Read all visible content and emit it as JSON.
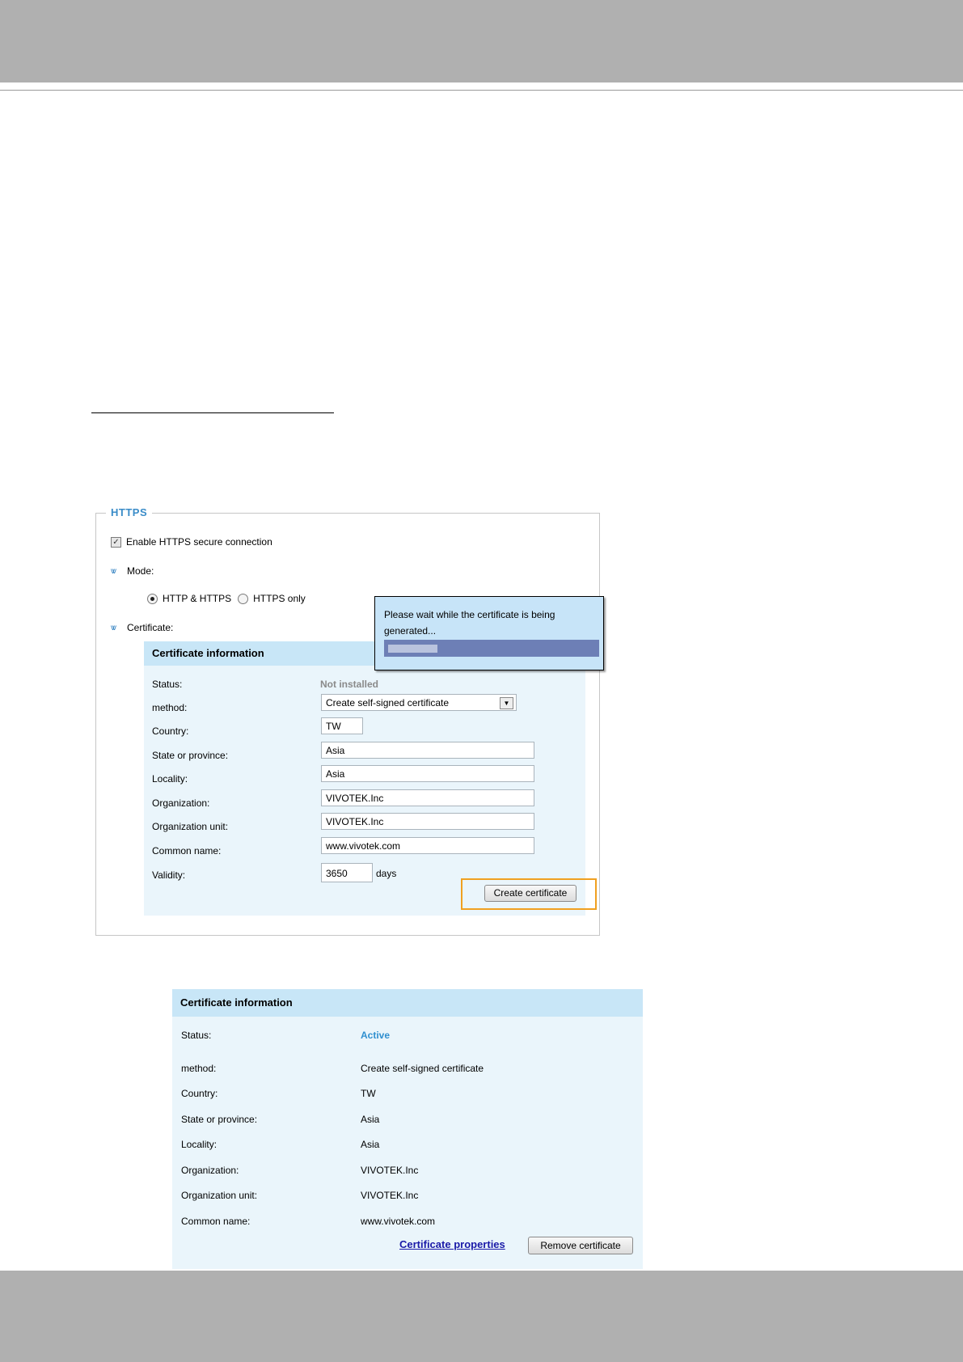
{
  "https": {
    "legend": "HTTPS",
    "enable_label": "Enable HTTPS secure connection",
    "mode_label": "Mode:",
    "mode_options": [
      "HTTP & HTTPS",
      "HTTPS only"
    ],
    "selected_mode": "HTTP & HTTPS",
    "certificate_label": "Certificate:",
    "check_mark": "✓",
    "chevron": "vv"
  },
  "cert_form": {
    "title": "Certificate information",
    "status_label": "Status:",
    "status_value": "Not installed",
    "method_label": "method:",
    "method_value": "Create self-signed certificate",
    "country_label": "Country:",
    "country_value": "TW",
    "state_label": "State or province:",
    "state_value": "Asia",
    "locality_label": "Locality:",
    "locality_value": "Asia",
    "org_label": "Organization:",
    "org_value": "VIVOTEK.Inc",
    "org_unit_label": "Organization unit:",
    "org_unit_value": "VIVOTEK.Inc",
    "common_name_label": "Common name:",
    "common_name_value": "www.vivotek.com",
    "validity_label": "Validity:",
    "validity_value": "3650",
    "validity_unit": "days",
    "create_button": "Create certificate",
    "dropdown_arrow": "▼"
  },
  "popup": {
    "message": "Please wait while the certificate is being generated..."
  },
  "cert_info": {
    "title": "Certificate information",
    "status_label": "Status:",
    "status_value": "Active",
    "method_label": "method:",
    "method_value": "Create self-signed certificate",
    "country_label": "Country:",
    "country_value": "TW",
    "state_label": "State or province:",
    "state_value": "Asia",
    "locality_label": "Locality:",
    "locality_value": "Asia",
    "org_label": "Organization:",
    "org_value": "VIVOTEK.Inc",
    "org_unit_label": "Organization unit:",
    "org_unit_value": "VIVOTEK.Inc",
    "common_name_label": "Common name:",
    "common_name_value": "www.vivotek.com",
    "properties_link": "Certificate properties",
    "remove_button": "Remove certificate"
  },
  "colors": {
    "accent": "#3a8cc8",
    "highlight": "#f0a020",
    "panel_bg": "#eaf5fb",
    "panel_head": "#c8e6f7"
  }
}
